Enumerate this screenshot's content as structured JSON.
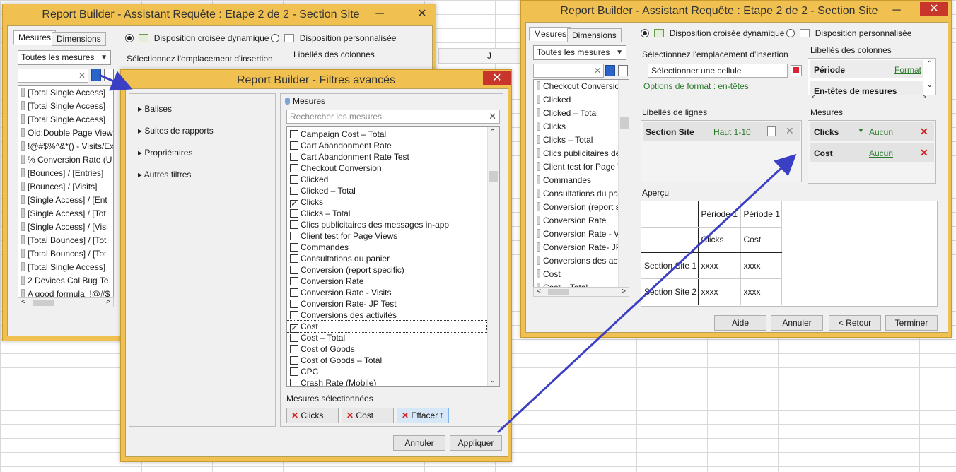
{
  "colors": {
    "frame": "#f0c050",
    "link": "#2b7a2b",
    "remove": "#d62020",
    "arrow": "#3b3fc4"
  },
  "grid_header_j": "J",
  "win1": {
    "title": "Report Builder - Assistant Requête : Etape 2 de 2 - Section Site",
    "tabs": [
      "Mesures",
      "Dimensions"
    ],
    "layout_dynamic": "Disposition croisée dynamique",
    "layout_custom": "Disposition personnalisée",
    "insert_label": "Sélectionnez l'emplacement d'insertion",
    "col_labels": "Libellés des colonnes",
    "measures_filter": "Toutes les mesures",
    "items": [
      "[Total Single Access]",
      "[Total Single Access]",
      "[Total Single Access]",
      "Old:Double Page View",
      "!@#$%^&*() - Visits/Ex",
      "% Conversion Rate (U",
      "[Bounces] / [Entries]",
      "[Bounces] / [Visits]",
      "[Single Access] / [Ent",
      "[Single Access] / [Tot",
      "[Single Access] / [Visi",
      "[Total Bounces] / [Tot",
      "[Total Bounces] / [Tot",
      "[Total Single Access]",
      "2 Devices Cal Bug Te",
      "A good formula: !@#$"
    ]
  },
  "win2": {
    "title": "Report Builder - Filtres avancés",
    "tree": [
      "Balises",
      "Suites de rapports",
      "Propriétaires",
      "Autres filtres"
    ],
    "measures_header": "Mesures",
    "search_placeholder": "Rechercher les mesures",
    "items": [
      {
        "label": "Campaign Cost – Total",
        "checked": false
      },
      {
        "label": "Cart Abandonment Rate",
        "checked": false
      },
      {
        "label": "Cart Abandonment Rate Test",
        "checked": false
      },
      {
        "label": "Checkout Conversion",
        "checked": false
      },
      {
        "label": "Clicked",
        "checked": false
      },
      {
        "label": "Clicked – Total",
        "checked": false
      },
      {
        "label": "Clicks",
        "checked": true
      },
      {
        "label": "Clicks – Total",
        "checked": false
      },
      {
        "label": "Clics publicitaires des messages in-app",
        "checked": false
      },
      {
        "label": "Client test for Page Views",
        "checked": false
      },
      {
        "label": "Commandes",
        "checked": false
      },
      {
        "label": "Consultations du panier",
        "checked": false
      },
      {
        "label": "Conversion (report specific)",
        "checked": false
      },
      {
        "label": "Conversion Rate",
        "checked": false
      },
      {
        "label": "Conversion Rate - Visits",
        "checked": false
      },
      {
        "label": "Conversion Rate- JP Test",
        "checked": false
      },
      {
        "label": "Conversions des activités",
        "checked": false
      },
      {
        "label": "Cost",
        "checked": true
      },
      {
        "label": "Cost – Total",
        "checked": false
      },
      {
        "label": "Cost of Goods",
        "checked": false
      },
      {
        "label": "Cost of Goods – Total",
        "checked": false
      },
      {
        "label": "CPC",
        "checked": false
      },
      {
        "label": "Crash Rate (Mobile)",
        "checked": false
      }
    ],
    "selected_label": "Mesures sélectionnées",
    "chips": [
      "Clicks",
      "Cost",
      "Effacer t"
    ],
    "cancel": "Annuler",
    "apply": "Appliquer"
  },
  "win3": {
    "title": "Report Builder - Assistant Requête : Etape 2 de 2 - Section Site",
    "tabs": [
      "Mesures",
      "Dimensions"
    ],
    "measures_filter": "Toutes les mesures",
    "items": [
      "Checkout Conversion",
      "Clicked",
      "Clicked – Total",
      "Clicks",
      "Clicks – Total",
      "Clics publicitaires des",
      "Client test for Page Vie",
      "Commandes",
      "Consultations du panie",
      "Conversion (report spe",
      "Conversion Rate",
      "Conversion Rate - Visi",
      "Conversion Rate- JP T",
      "Conversions des activ",
      "Cost",
      "Cost – Total"
    ],
    "layout_dynamic": "Disposition croisée dynamique",
    "layout_custom": "Disposition personnalisée",
    "insert_label": "Sélectionnez l'emplacement d'insertion",
    "cell_value": "Sélectionner une cellule",
    "format_link": "Options de format : en-têtes",
    "col_labels": "Libellés des colonnes",
    "col_items": [
      {
        "name": "Période",
        "link": "Format"
      },
      {
        "name": "En-têtes de mesures",
        "link": ""
      }
    ],
    "row_labels": "Libellés de lignes",
    "row_item": {
      "name": "Section Site",
      "link": "Haut 1-10"
    },
    "measures_label": "Mesures",
    "measures": [
      {
        "name": "Clicks",
        "link": "Aucun"
      },
      {
        "name": "Cost",
        "link": "Aucun"
      }
    ],
    "preview_label": "Aperçu",
    "preview": {
      "header1": [
        "",
        "Période 1",
        "Période 1"
      ],
      "header2": [
        "",
        "Clicks",
        "Cost"
      ],
      "rows": [
        [
          "Section Site 1",
          "xxxx",
          "xxxx"
        ],
        [
          "Section Site 2",
          "xxxx",
          "xxxx"
        ]
      ]
    },
    "buttons": {
      "help": "Aide",
      "cancel": "Annuler",
      "back": "< Retour",
      "finish": "Terminer"
    }
  }
}
